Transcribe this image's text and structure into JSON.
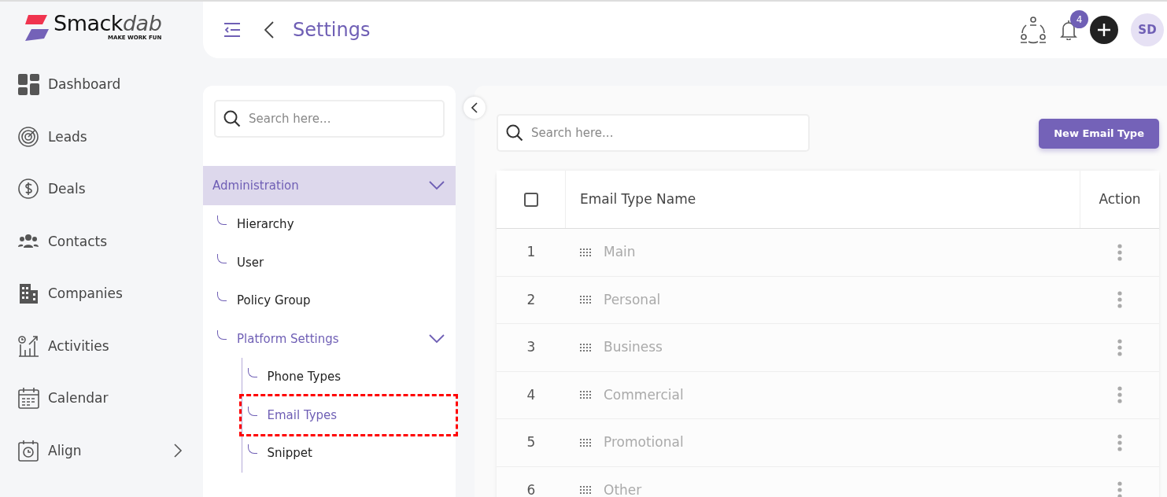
{
  "brand": {
    "name_strong": "Smack",
    "name_light": "dab",
    "tagline": "MAKE WORK FUN"
  },
  "nav": [
    {
      "label": "Dashboard",
      "has_submenu": false
    },
    {
      "label": "Leads",
      "has_submenu": false
    },
    {
      "label": "Deals",
      "has_submenu": false
    },
    {
      "label": "Contacts",
      "has_submenu": false
    },
    {
      "label": "Companies",
      "has_submenu": false
    },
    {
      "label": "Activities",
      "has_submenu": false
    },
    {
      "label": "Calendar",
      "has_submenu": false
    },
    {
      "label": "Align",
      "has_submenu": true
    }
  ],
  "header": {
    "title": "Settings",
    "notification_count": "4",
    "avatar": "SD"
  },
  "settings_menu": {
    "search": {
      "placeholder": "Search here..."
    },
    "tree": [
      {
        "label": "Administration",
        "expanded": true,
        "selected": false,
        "children": [
          {
            "label": "Hierarchy",
            "selected": false,
            "highlighted": false
          },
          {
            "label": "User",
            "selected": false,
            "highlighted": false
          },
          {
            "label": "Policy Group",
            "selected": false,
            "highlighted": false
          },
          {
            "label": "Platform Settings",
            "expanded": true,
            "selected": true,
            "highlighted": false,
            "children": [
              {
                "label": "Phone Types",
                "selected": false,
                "highlighted": false
              },
              {
                "label": "Email Types",
                "selected": true,
                "highlighted": true
              },
              {
                "label": "Snippet",
                "selected": false,
                "highlighted": false
              }
            ]
          }
        ]
      }
    ]
  },
  "content": {
    "search": {
      "placeholder": "Search here..."
    },
    "new_button": "New Email Type",
    "table": {
      "select_all_checked": false,
      "columns": [
        "Email Type Name",
        "Action"
      ],
      "rows": [
        {
          "number": "1",
          "name": "Main"
        },
        {
          "number": "2",
          "name": "Personal"
        },
        {
          "number": "3",
          "name": "Business"
        },
        {
          "number": "4",
          "name": "Commercial"
        },
        {
          "number": "5",
          "name": "Promotional"
        },
        {
          "number": "6",
          "name": "Other"
        }
      ]
    }
  }
}
